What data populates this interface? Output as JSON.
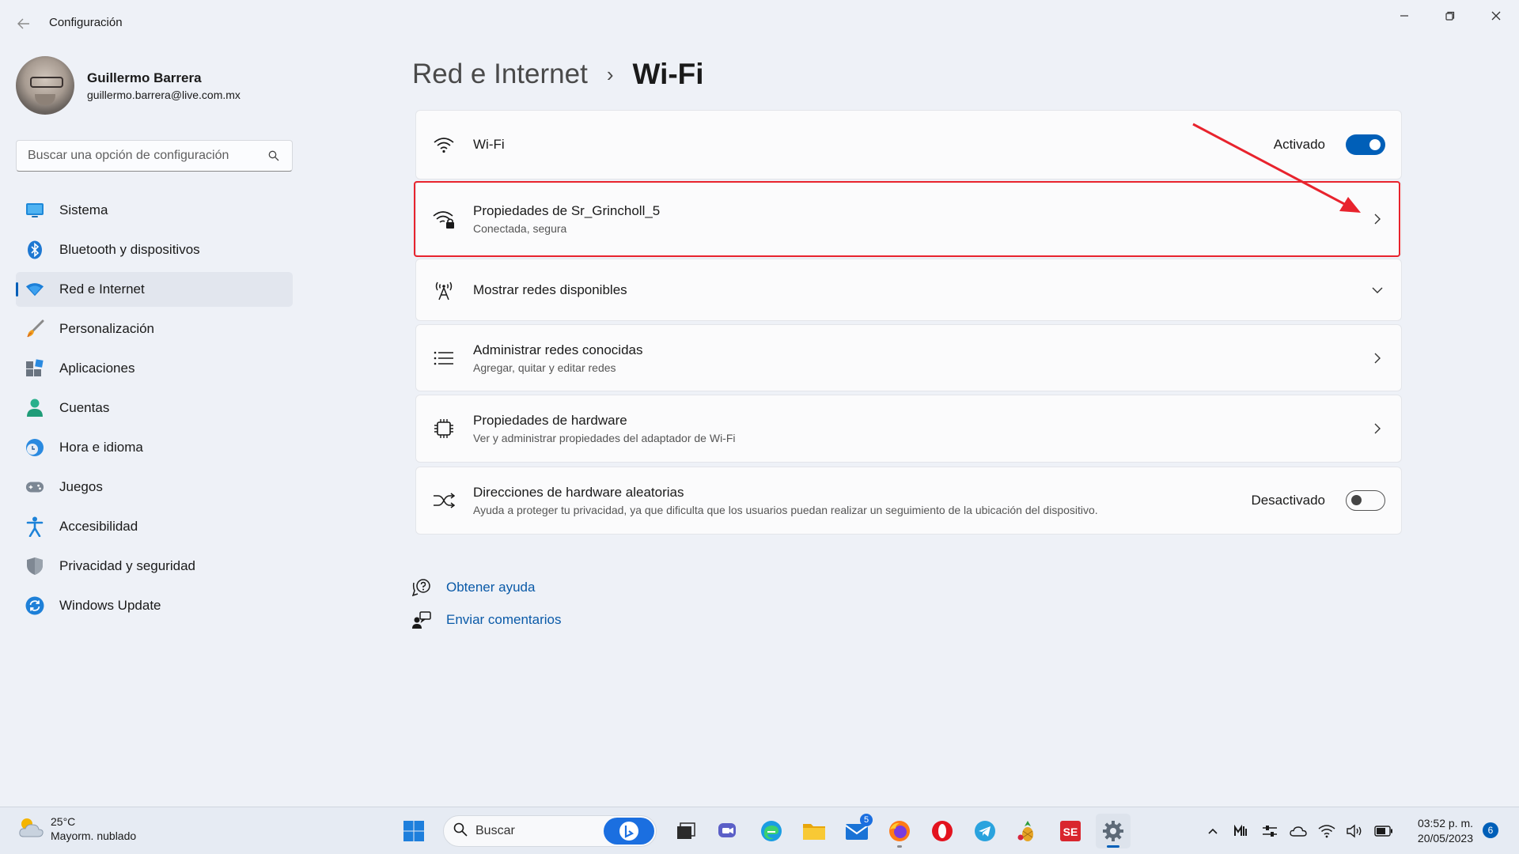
{
  "window": {
    "app_title": "Configuración",
    "back_icon": "back-arrow-icon",
    "minimize_icon": "minimize-icon",
    "maximize_icon": "restore-icon",
    "close_icon": "close-icon"
  },
  "profile": {
    "name": "Guillermo Barrera",
    "email": "guillermo.barrera@live.com.mx"
  },
  "search": {
    "placeholder": "Buscar una opción de configuración"
  },
  "sidebar": {
    "active_index": 2,
    "items": [
      {
        "label": "Sistema",
        "icon": "monitor-icon"
      },
      {
        "label": "Bluetooth y dispositivos",
        "icon": "bluetooth-icon"
      },
      {
        "label": "Red e Internet",
        "icon": "wifi-diamond-icon"
      },
      {
        "label": "Personalización",
        "icon": "brush-icon"
      },
      {
        "label": "Aplicaciones",
        "icon": "apps-icon"
      },
      {
        "label": "Cuentas",
        "icon": "person-icon"
      },
      {
        "label": "Hora e idioma",
        "icon": "globe-clock-icon"
      },
      {
        "label": "Juegos",
        "icon": "gamepad-icon"
      },
      {
        "label": "Accesibilidad",
        "icon": "accessibility-icon"
      },
      {
        "label": "Privacidad y seguridad",
        "icon": "shield-icon"
      },
      {
        "label": "Windows Update",
        "icon": "sync-icon"
      }
    ]
  },
  "breadcrumb": {
    "parent": "Red e Internet",
    "separator": "›",
    "current": "Wi-Fi"
  },
  "settings": {
    "wifi": {
      "title": "Wi-Fi",
      "state_label": "Activado",
      "on": true
    },
    "network_properties": {
      "title": "Propiedades de Sr_Grincholl_5",
      "subtitle": "Conectada, segura"
    },
    "available_networks": {
      "title": "Mostrar redes disponibles"
    },
    "known_networks": {
      "title": "Administrar redes conocidas",
      "subtitle": "Agregar, quitar y editar redes"
    },
    "hardware_properties": {
      "title": "Propiedades de hardware",
      "subtitle": "Ver y administrar propiedades del adaptador de Wi-Fi"
    },
    "random_addresses": {
      "title": "Direcciones de hardware aleatorias",
      "subtitle": "Ayuda a proteger tu privacidad, ya que dificulta que los usuarios puedan realizar un seguimiento de la ubicación del dispositivo.",
      "state_label": "Desactivado",
      "on": false
    }
  },
  "links": {
    "help": "Obtener ayuda",
    "feedback": "Enviar comentarios"
  },
  "annotation": {
    "highlight_color": "#e8232d",
    "arrow_color": "#e8232d"
  },
  "taskbar": {
    "weather_temp": "25°C",
    "weather_desc": "Mayorm. nublado",
    "search_label": "Buscar",
    "mail_badge": "5",
    "time": "03:52 p. m.",
    "date": "20/05/2023",
    "notifications": "6"
  },
  "colors": {
    "accent": "#005fb8",
    "link": "#0a5aa8",
    "background": "#eef1f7",
    "card": "#fbfbfc"
  }
}
